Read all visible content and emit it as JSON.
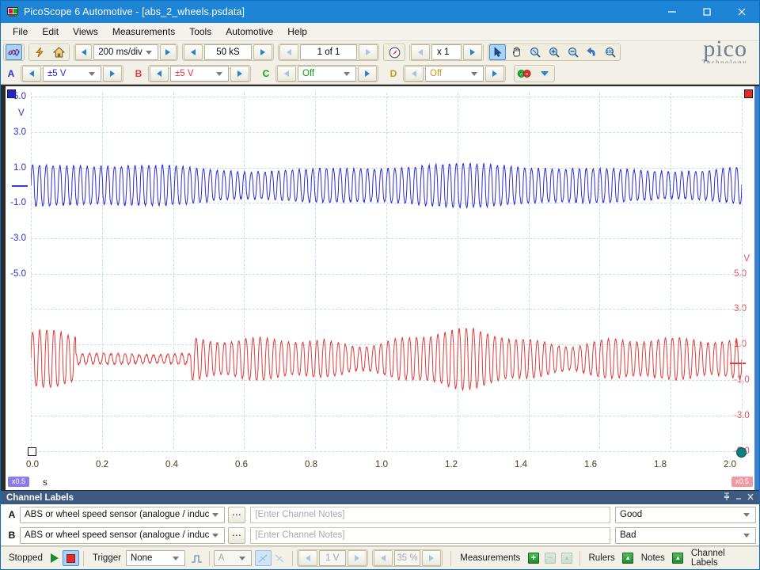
{
  "window": {
    "title": "PicoScope 6 Automotive - [abs_2_wheels.psdata]",
    "app_icon": "scope-icon",
    "minimize": "—",
    "maximize": "□",
    "close": "✕"
  },
  "menubar": {
    "items": [
      "File",
      "Edit",
      "Views",
      "Measurements",
      "Tools",
      "Automotive",
      "Help"
    ]
  },
  "toolbar_main": {
    "mode_scope_icon": "waveform-icon",
    "quick_icon": "lightning-icon",
    "home_icon": "home-icon",
    "timebase": {
      "value": "200 ms/div",
      "prev": "◀",
      "next": "▶"
    },
    "samples": {
      "value": "50 kS",
      "prev": "◀",
      "next": "▶"
    },
    "waveform_nav": {
      "value": "1 of 1",
      "prev": "◀",
      "next": "▶"
    },
    "compass_icon": "compass-icon",
    "zoom_factor": {
      "value": "x 1",
      "prev": "◀",
      "next": "▶"
    },
    "tools": [
      {
        "name": "pointer-tool",
        "icon": "arrow-cursor-icon",
        "selected": true
      },
      {
        "name": "hand-tool",
        "icon": "hand-icon",
        "selected": false
      },
      {
        "name": "zoom-select-tool",
        "icon": "magnifier-select-icon",
        "selected": false
      },
      {
        "name": "zoom-in-tool",
        "icon": "magnifier-plus-icon",
        "selected": false
      },
      {
        "name": "zoom-out-tool",
        "icon": "magnifier-minus-icon",
        "selected": false
      },
      {
        "name": "undo-zoom-tool",
        "icon": "undo-arrow-icon",
        "selected": false
      },
      {
        "name": "zoom-100-tool",
        "icon": "magnifier-100-icon",
        "selected": false
      }
    ],
    "logo": {
      "word": "pico",
      "tagline": "Technology"
    }
  },
  "toolbar_channels": {
    "channels": [
      {
        "letter": "A",
        "range": "±5 V",
        "color": "#2b2bd4",
        "enabled": true
      },
      {
        "letter": "B",
        "range": "±5 V",
        "color": "#e23a3a",
        "enabled": true
      },
      {
        "letter": "C",
        "range": "Off",
        "color": "#11a011",
        "enabled": false
      },
      {
        "letter": "D",
        "range": "Off",
        "color": "#c79a1e",
        "enabled": false
      }
    ],
    "ab_toggle_icon": "channel-ab-icon",
    "dropdown_caret": "▾"
  },
  "scope": {
    "channel_a_marker": "channel-a-offset-marker",
    "channel_b_marker": "channel-b-offset-marker",
    "trigger_marker": "trigger-marker",
    "post_marker": "post-trigger-marker",
    "zoom_tag_left": "x0.5",
    "zoom_tag_right": "x0.5",
    "x_unit": "s",
    "y_unit_left": "V",
    "y_unit_right": "V"
  },
  "chart_data": {
    "type": "line",
    "title": "",
    "xlabel": "s",
    "ylabel": "V",
    "xlim": [
      0.0,
      2.0
    ],
    "x_ticks": [
      "0.0",
      "0.2",
      "0.4",
      "0.6",
      "0.8",
      "1.0",
      "1.2",
      "1.4",
      "1.6",
      "1.8",
      "2.0"
    ],
    "grid": true,
    "legend": "none",
    "axes": [
      {
        "id": "left",
        "channel": "A",
        "color": "#2b2bd4",
        "unit": "V",
        "ylim": [
          -5.0,
          5.0
        ],
        "y_ticks": [
          "5.0",
          "3.0",
          "1.0",
          "-1.0",
          "-3.0",
          "-5.0"
        ],
        "range_setting": "±5 V"
      },
      {
        "id": "right",
        "channel": "B",
        "color": "#e23a3a",
        "unit": "V",
        "ylim": [
          -5.0,
          5.0
        ],
        "y_ticks": [
          "5.0",
          "3.0",
          "1.0",
          "-1.0",
          "-3.0",
          "-5.0"
        ],
        "range_setting": "±5 V"
      }
    ],
    "series": [
      {
        "name": "Channel A",
        "color": "#2b2bd4",
        "axis": "left",
        "label": "ABS or wheel speed sensor (analogue / inductive)",
        "verdict": "Good",
        "waveform": "inductive-ac-burst",
        "approx_amplitude_v": 1.0,
        "approx_offset_v": -0.1,
        "approx_frequency_hz": 52,
        "sample_count": 50000
      },
      {
        "name": "Channel B",
        "color": "#e23a3a",
        "axis": "right",
        "label": "ABS or wheel speed sensor (analogue / inductive)",
        "verdict": "Bad",
        "waveform": "inductive-ac-burst-irregular",
        "approx_amplitude_v": 1.1,
        "approx_offset_v": -0.05,
        "approx_frequency_hz": 50,
        "sample_count": 50000
      }
    ]
  },
  "channel_labels_pane": {
    "title": "Channel Labels",
    "pin_icon": "丂",
    "minimize_icon": "–",
    "close_icon": "✕",
    "notes_placeholder": "[Enter Channel Notes]",
    "rows": [
      {
        "letter": "A",
        "label": "ABS or wheel speed sensor (analogue / induc",
        "notes": "",
        "verdict": "Good"
      },
      {
        "letter": "B",
        "label": "ABS or wheel speed sensor (analogue / induc",
        "notes": "",
        "verdict": "Bad"
      }
    ]
  },
  "statusbar": {
    "run_state": "Stopped",
    "start_icon": "play-icon",
    "stop_icon": "stop-icon",
    "trigger_label": "Trigger",
    "trigger_mode": "None",
    "trigger_advanced_icon": "trigger-pulse-icon",
    "trigger_source": "A",
    "rising_edge_icon": "rising-edge-icon",
    "falling_edge_icon": "falling-edge-icon",
    "trigger_level": "1 V",
    "pretrigger": "35 %",
    "measurements_label": "Measurements",
    "measure_add_icon": "plus-icon",
    "measure_remove_icon": "minus-icon",
    "measure_edit_icon": "panel-icon",
    "rulers_label": "Rulers",
    "rulers_icon": "panel-icon",
    "notes_label": "Notes",
    "notes_icon": "panel-icon",
    "channel_labels_label": "Channel Labels"
  }
}
